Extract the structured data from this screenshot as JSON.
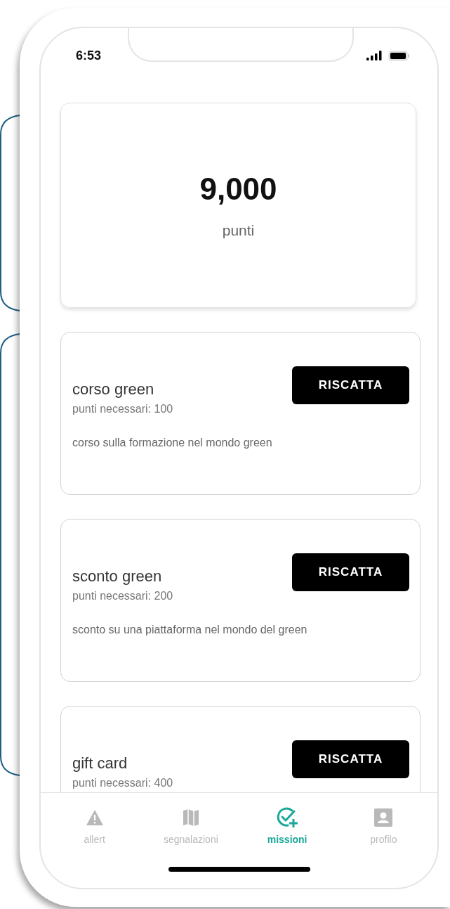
{
  "status_bar": {
    "time": "6:53"
  },
  "points": {
    "value": "9,000",
    "label": "punti"
  },
  "rewards": [
    {
      "title": "corso green",
      "points": "punti necessari: 100",
      "description": "corso sulla formazione nel mondo green",
      "button": "RISCATTA"
    },
    {
      "title": "sconto green",
      "points": "punti necessari: 200",
      "description": "sconto su una piattaforma nel mondo del green",
      "button": "RISCATTA"
    },
    {
      "title": "gift card",
      "points": "punti necessari: 400",
      "button": "RISCATTA"
    }
  ],
  "nav": [
    {
      "label": "allert",
      "kind": "warning",
      "selected": false
    },
    {
      "label": "segnalazioni",
      "kind": "map",
      "selected": false
    },
    {
      "label": "missioni",
      "kind": "mission",
      "selected": true
    },
    {
      "label": "profilo",
      "kind": "profile",
      "selected": false
    }
  ]
}
